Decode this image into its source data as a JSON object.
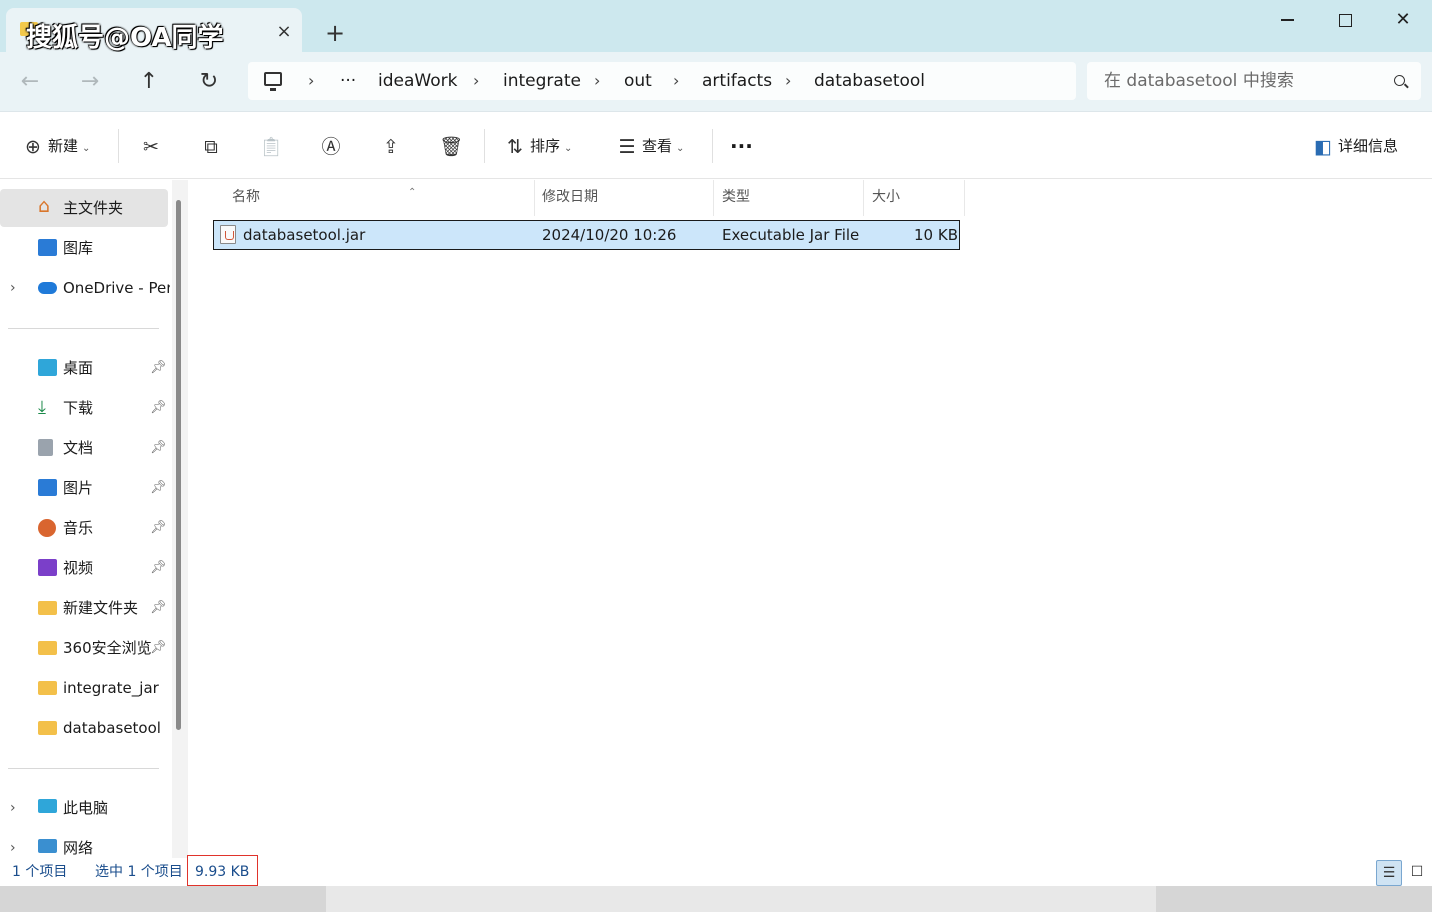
{
  "window": {
    "tab_title": "搜狐号@OA同学",
    "tab_close": "×",
    "new_tab": "+"
  },
  "nav": {
    "back": "←",
    "forward": "→",
    "up": "↑",
    "refresh": "↻"
  },
  "address": {
    "overflow": "···",
    "crumbs": [
      "ideaWork",
      "integrate",
      "out",
      "artifacts",
      "databasetool"
    ],
    "separator": "›"
  },
  "search": {
    "placeholder": "在 databasetool 中搜索"
  },
  "toolbar": {
    "new_label": "新建",
    "sort_label": "排序",
    "view_label": "查看",
    "more_label": "···",
    "details_label": "详细信息"
  },
  "sidebar": {
    "home": "主文件夹",
    "gallery": "图库",
    "onedrive": "OneDrive - Per",
    "quick": [
      {
        "label": "桌面"
      },
      {
        "label": "下载"
      },
      {
        "label": "文档"
      },
      {
        "label": "图片"
      },
      {
        "label": "音乐"
      },
      {
        "label": "视频"
      },
      {
        "label": "新建文件夹"
      },
      {
        "label": "360安全浏览"
      },
      {
        "label": "integrate_jar"
      },
      {
        "label": "databasetool"
      }
    ],
    "this_pc": "此电脑",
    "network": "网络"
  },
  "columns": {
    "name": "名称",
    "modified": "修改日期",
    "type": "类型",
    "size": "大小"
  },
  "files": [
    {
      "name": "databasetool.jar",
      "modified": "2024/10/20 10:26",
      "type": "Executable Jar File",
      "size": "10 KB"
    }
  ],
  "status": {
    "count": "1 个项目",
    "selected": "选中 1 个项目",
    "selected_size": "9.93 KB"
  },
  "colors": {
    "titlebar": "#cde8ee",
    "selection": "#cce6fa",
    "highlight_box": "#e0332b"
  }
}
